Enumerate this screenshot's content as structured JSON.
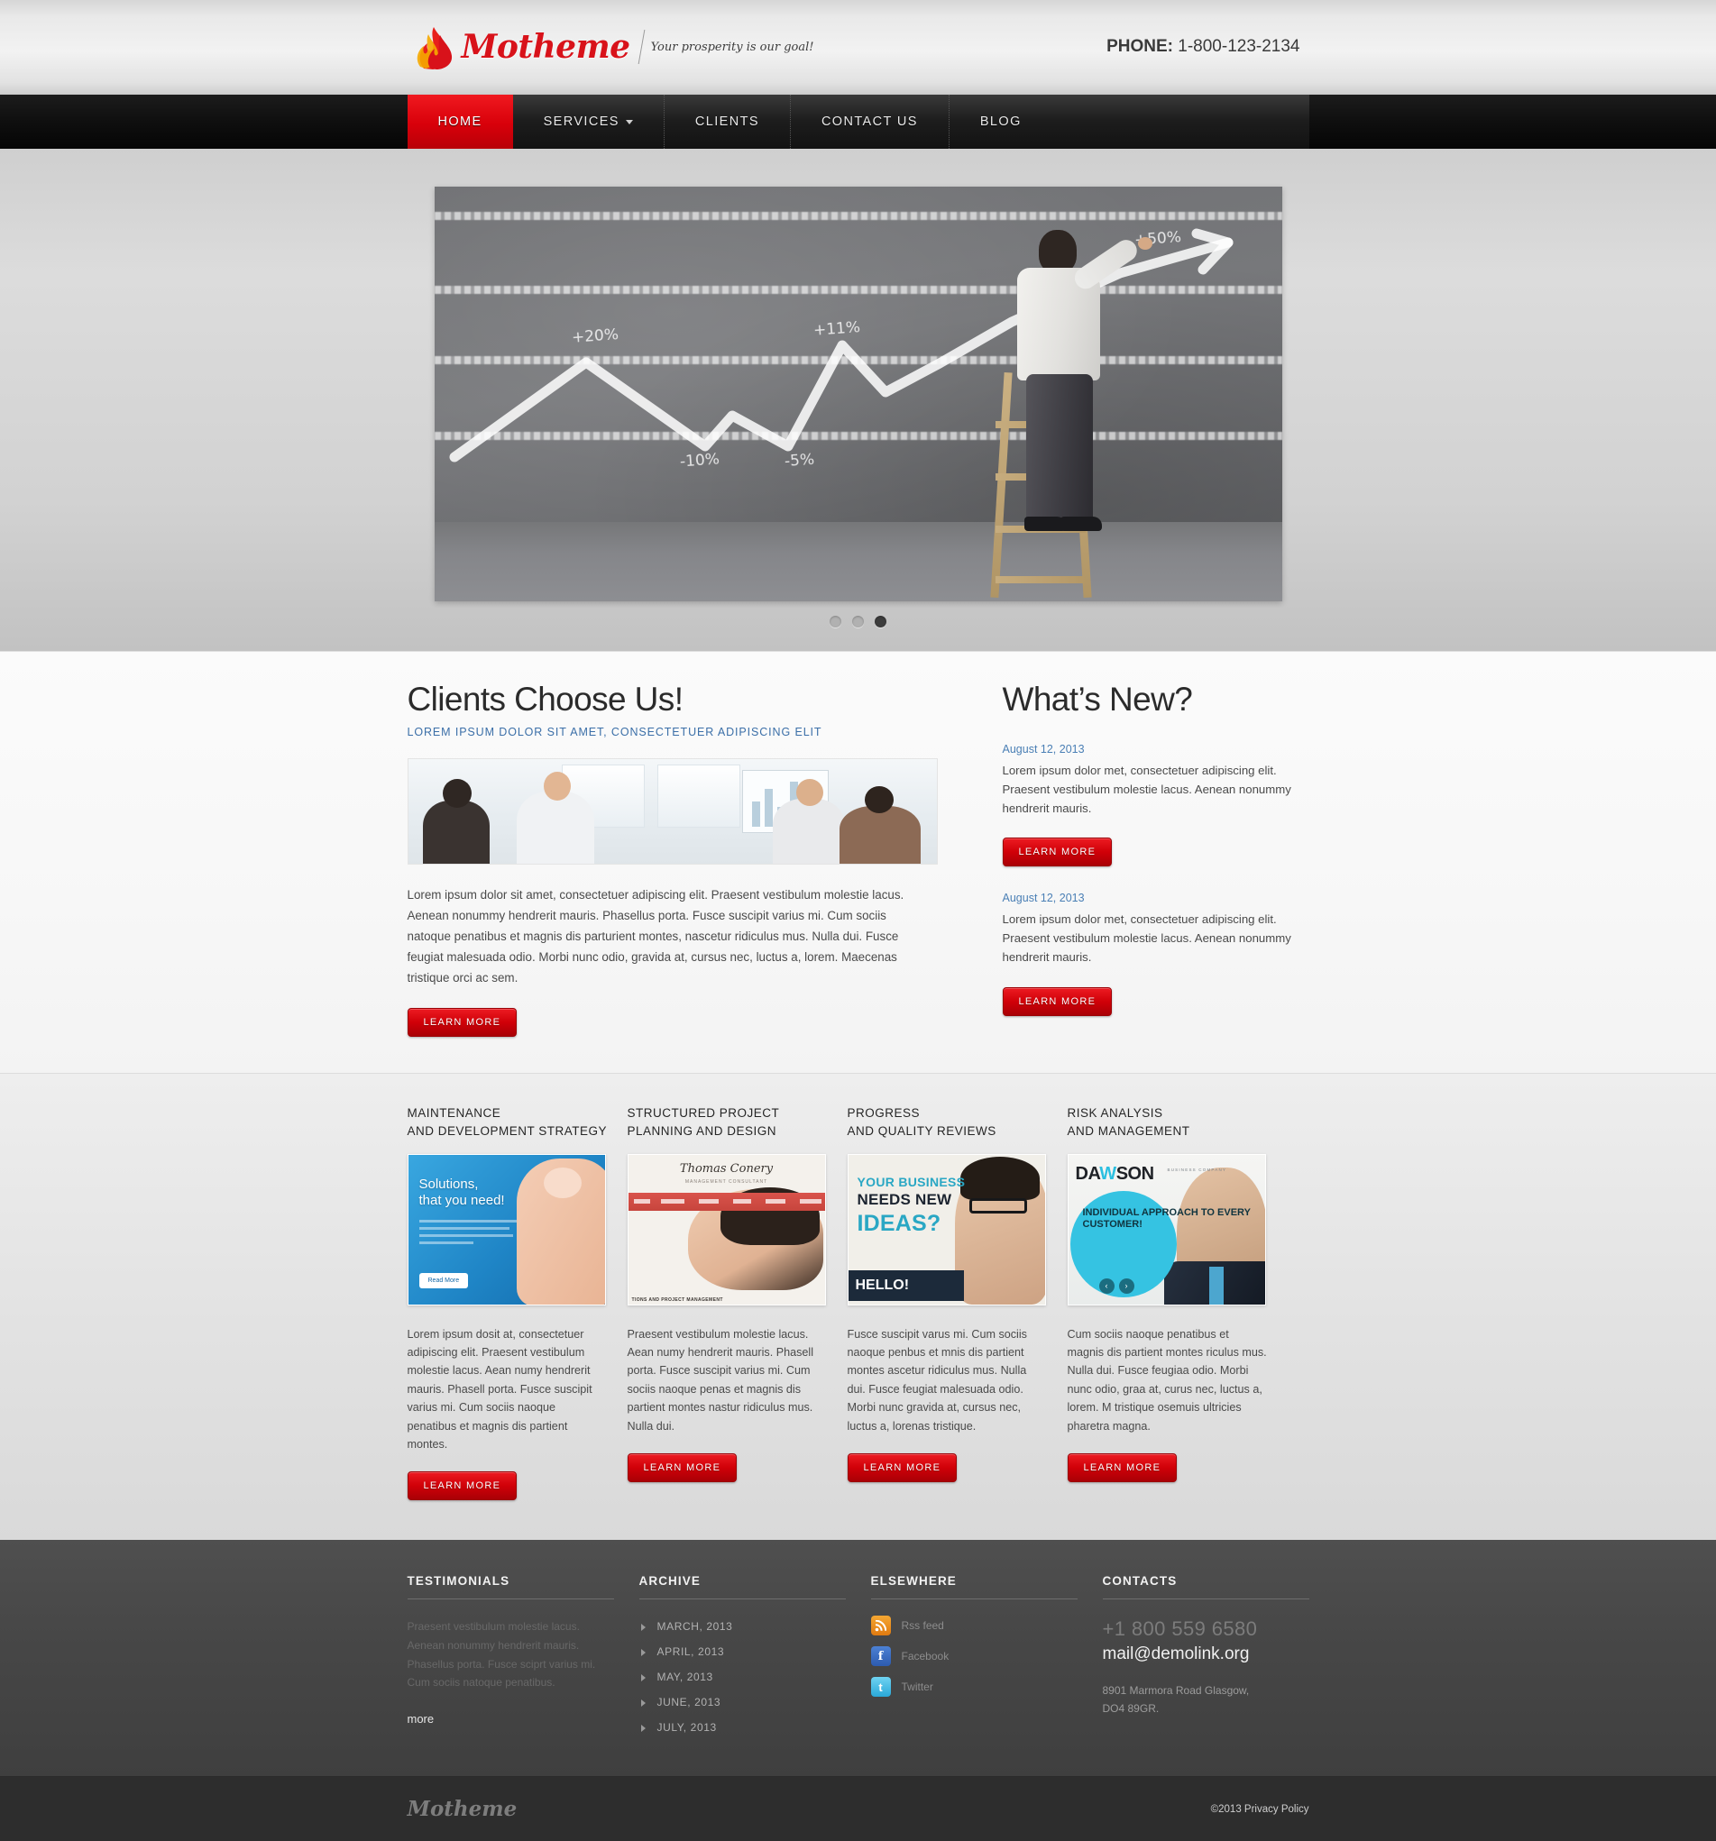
{
  "header": {
    "logo_text": "Motheme",
    "tagline": "Your prosperity is our goal!",
    "phone_label": "PHONE:",
    "phone_number": "1-800-123-2134"
  },
  "nav": {
    "items": [
      {
        "label": "HOME",
        "active": true,
        "has_dropdown": false
      },
      {
        "label": "SERVICES",
        "active": false,
        "has_dropdown": true
      },
      {
        "label": "CLIENTS",
        "active": false,
        "has_dropdown": false
      },
      {
        "label": "CONTACT US",
        "active": false,
        "has_dropdown": false
      },
      {
        "label": "BLOG",
        "active": false,
        "has_dropdown": false
      }
    ]
  },
  "slider": {
    "slide_alt": "Businessman on ladder drawing chalk growth chart on blackboard",
    "chalk_labels": [
      "+20%",
      "+11%",
      "-10%",
      "-5%",
      "+50%"
    ],
    "dots": [
      {
        "active": false
      },
      {
        "active": false
      },
      {
        "active": true
      }
    ]
  },
  "main": {
    "left": {
      "heading": "Clients Choose Us!",
      "subheading": "LOREM IPSUM DOLOR SIT AMET, CONSECTETUER ADIPISCING ELIT",
      "image_alt": "Team of colleagues in a bright office meeting",
      "paragraph": "Lorem ipsum dolor sit amet, consectetuer adipiscing elit. Praesent vestibulum molestie lacus. Aenean nonummy hendrerit mauris. Phasellus porta. Fusce suscipit varius mi. Cum sociis natoque penatibus et magnis dis parturient montes, nascetur ridiculus mus. Nulla dui. Fusce feugiat malesuada odio. Morbi nunc odio, gravida at, cursus nec, luctus a, lorem. Maecenas tristique orci ac sem.",
      "button_label": "LEARN MORE"
    },
    "right": {
      "heading": "What’s New?",
      "items": [
        {
          "date": "August 12, 2013",
          "text": "Lorem ipsum dolor met, consectetuer adipiscing elit. Praesent vestibulum molestie lacus. Aenean nonummy hendrerit mauris.",
          "button_label": "LEARN MORE"
        },
        {
          "date": "August 12, 2013",
          "text": "Lorem ipsum dolor met, consectetuer adipiscing elit. Praesent vestibulum molestie lacus. Aenean nonummy hendrerit mauris.",
          "button_label": "LEARN MORE"
        }
      ]
    }
  },
  "services": [
    {
      "title_line1": "MAINTENANCE",
      "title_line2": "AND DEVELOPMENT STRATEGY",
      "thumb": {
        "headline_line1": "Solutions,",
        "headline_line2": "that you need!",
        "button_label": "Read More"
      },
      "text": "Lorem ipsum dosit at, consectetuer adipiscing elit. Praesent vestibulum molestie lacus. Aean numy hendrerit mauris. Phasell porta. Fusce suscipit varius mi. Cum sociis naoque penatibus et magnis dis partient montes.",
      "button_label": "LEARN MORE"
    },
    {
      "title_line1": "STRUCTURED PROJECT",
      "title_line2": "PLANNING AND DESIGN",
      "thumb": {
        "brand": "Thomas Conery",
        "brand_sub": "MANAGEMENT CONSULTANT",
        "footer_text": "TIONS AND PROJECT MANAGEMENT"
      },
      "text": "Praesent vestibulum molestie lacus. Aean numy hendrerit mauris. Phasell porta. Fusce suscipit varius mi. Cum sociis naoque penas et magnis dis partient montes nastur ridiculus mus. Nulla dui.",
      "button_label": "LEARN MORE"
    },
    {
      "title_line1": "PROGRESS",
      "title_line2": "AND QUALITY REVIEWS",
      "thumb": {
        "line1": "YOUR BUSINESS",
        "line2": "NEEDS NEW",
        "line3": "IDEAS?",
        "banner": "HELLO!"
      },
      "text": "Fusce suscipit varus mi. Cum sociis naoque penbus et mnis dis partient montes ascetur ridiculus mus. Nulla dui. Fusce feugiat malesuada odio. Morbi nunc  gravida at, cursus nec, luctus a, lorenas tristique.",
      "button_label": "LEARN MORE"
    },
    {
      "title_line1": "RISK ANALYSIS",
      "title_line2": "AND MANAGEMENT",
      "thumb": {
        "brand_a": "DA",
        "brand_w": "W",
        "brand_b": "SON",
        "brand_sub": "BUSINESS COMPANY",
        "bubble_text": "INDIVIDUAL APPROACH TO EVERY CUSTOMER!",
        "prev_arrow": "‹",
        "next_arrow": "›"
      },
      "text": "Cum sociis naoque penatibus et magnis dis partient montes riculus mus. Nulla dui. Fusce feugiaa odio. Morbi nunc odio, graa at, curus nec, luctus a, lorem. M tristique osemuis ultricies pharetra magna.",
      "button_label": "LEARN MORE"
    }
  ],
  "footer": {
    "testimonials": {
      "title": "TESTIMONIALS",
      "text": "Praesent vestibulum molestie lacus. Aenean nonummy hendrerit mauris. Phasellus porta. Fusce sciprt varius mi. Cum sociis natoque penatibus.",
      "more_label": "more"
    },
    "archive": {
      "title": "ARCHIVE",
      "items": [
        "MARCH, 2013",
        "APRIL, 2013",
        "MAY, 2013",
        "JUNE, 2013",
        "JULY, 2013"
      ]
    },
    "elsewhere": {
      "title": "ELSEWHERE",
      "items": [
        {
          "label": "Rss feed",
          "icon": "rss-icon",
          "glyph": "◔"
        },
        {
          "label": "Facebook",
          "icon": "facebook-icon",
          "glyph": "f"
        },
        {
          "label": "Twitter",
          "icon": "twitter-icon",
          "glyph": "t"
        }
      ]
    },
    "contacts": {
      "title": "CONTACTS",
      "phone": "+1 800 559 6580",
      "email": "mail@demolink.org",
      "address_line1": "8901 Marmora Road Glasgow,",
      "address_line2": "DO4 89GR."
    }
  },
  "bottombar": {
    "logo": "Motheme",
    "copyright": "©2013 Privacy Policy"
  },
  "colors": {
    "accent_red": "#d8121a",
    "link_blue": "#4a7fb5",
    "nav_dark": "#141414",
    "footer_gray": "#474747"
  }
}
